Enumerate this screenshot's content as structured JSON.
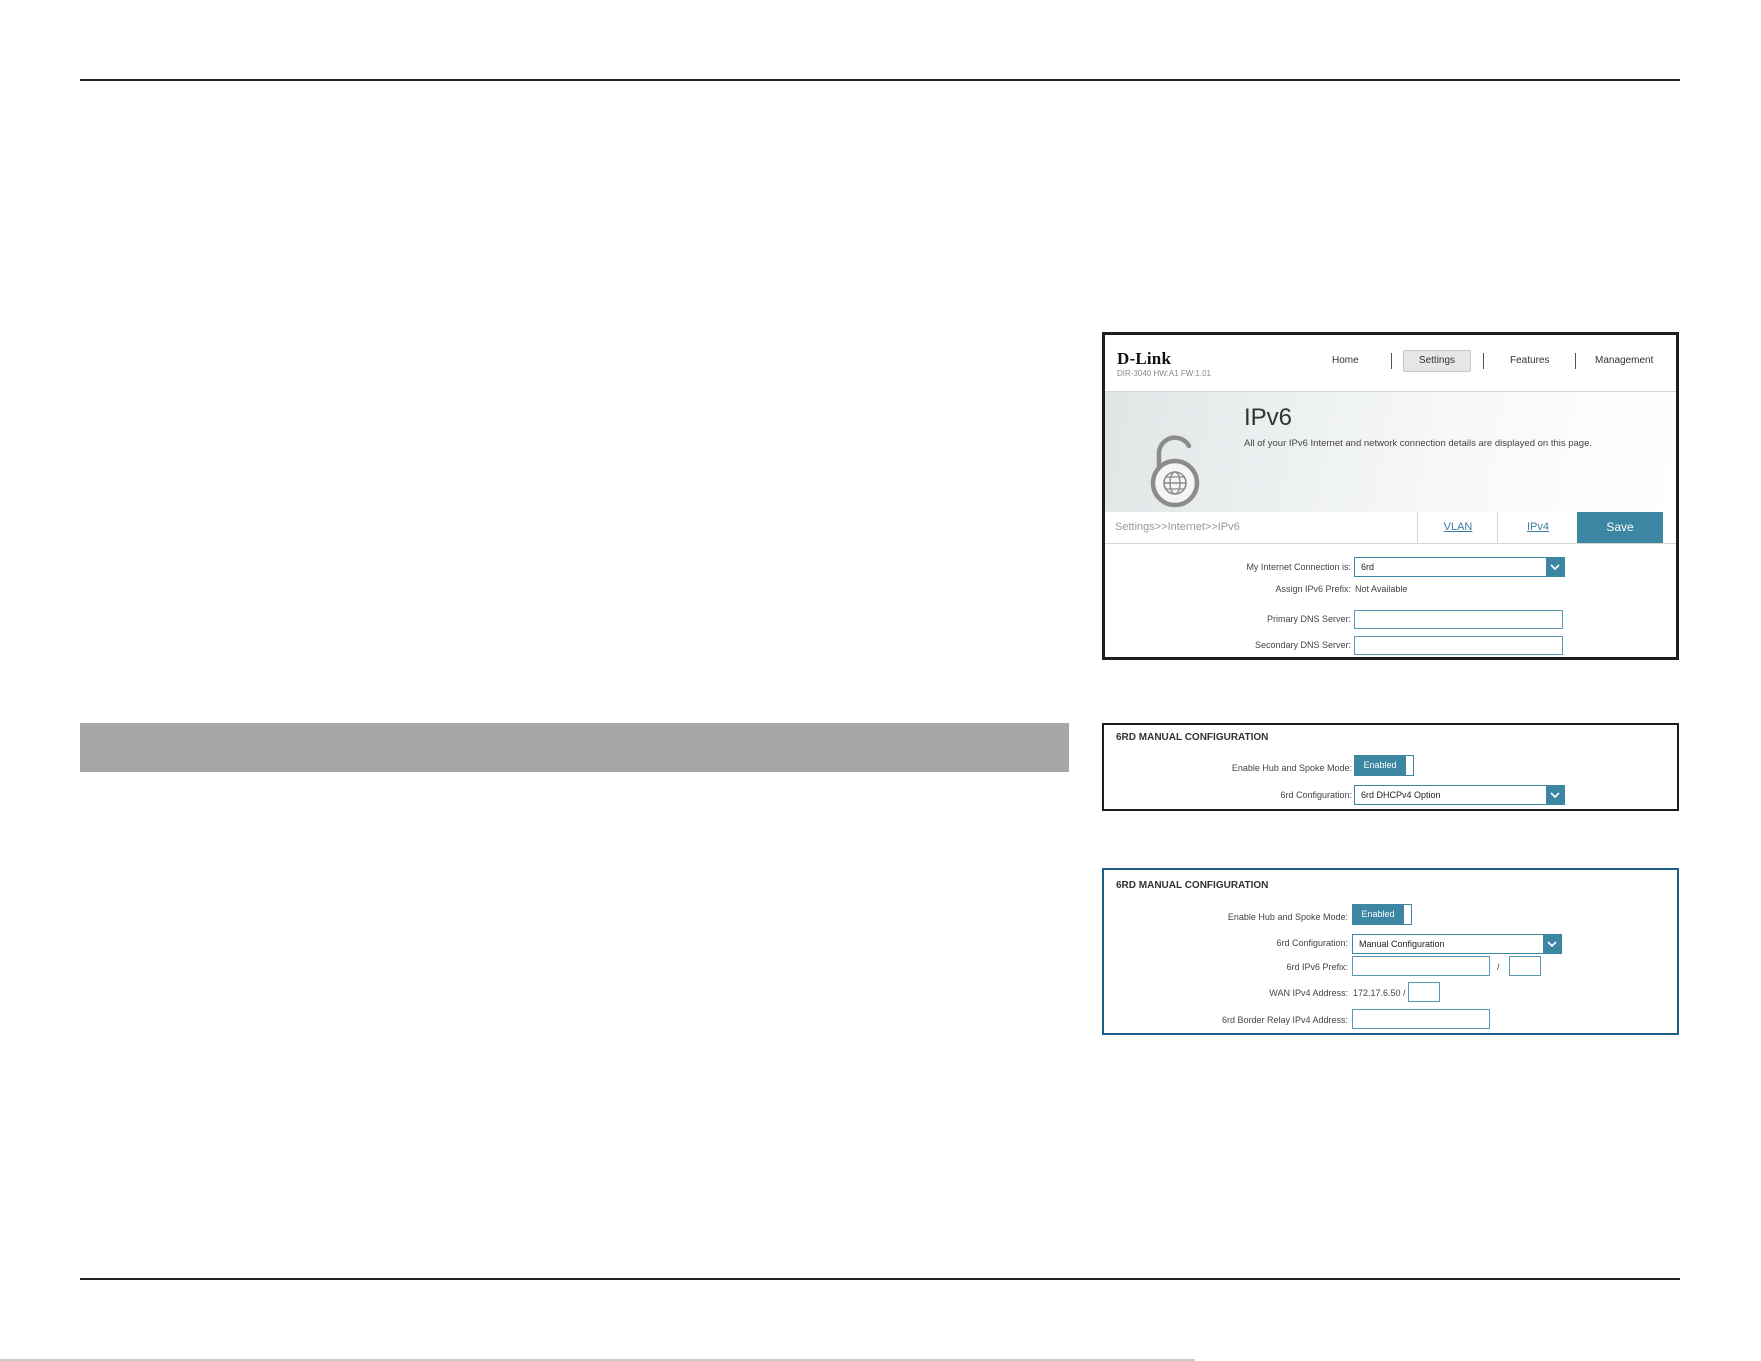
{
  "main": {
    "logo": "D-Link",
    "model": "DIR-3040 HW:A1 FW:1.01",
    "nav": {
      "home": "Home",
      "settings": "Settings",
      "features": "Features",
      "management": "Management"
    },
    "page_title": "IPv6",
    "page_description": "All of your IPv6 Internet and network connection details are displayed on this page.",
    "breadcrumb": "Settings>>Internet>>IPv6",
    "tabs": {
      "vlan": "VLAN",
      "ipv4": "IPv4"
    },
    "save_label": "Save",
    "fields": {
      "connection_label": "My Internet Connection is:",
      "connection_value": "6rd",
      "prefix_label": "Assign IPv6 Prefix:",
      "prefix_value": "Not Available",
      "primary_dns_label": "Primary DNS Server:",
      "secondary_dns_label": "Secondary DNS Server:"
    }
  },
  "panel_dhcp": {
    "heading": "6RD MANUAL CONFIGURATION",
    "hub_spoke_label": "Enable Hub and Spoke Mode:",
    "hub_spoke_state": "Enabled",
    "config_label": "6rd Configuration:",
    "config_value": "6rd DHCPv4 Option"
  },
  "panel_manual": {
    "heading": "6RD MANUAL CONFIGURATION",
    "hub_spoke_label": "Enable Hub and Spoke Mode:",
    "hub_spoke_state": "Enabled",
    "config_label": "6rd Configuration:",
    "config_value": "Manual Configuration",
    "ipv6_prefix_label": "6rd IPv6 Prefix:",
    "prefix_separator": "/",
    "wan_ipv4_label": "WAN IPv4 Address:",
    "wan_ipv4_value": "172.17.6.50 /",
    "border_relay_label": "6rd Border Relay IPv4 Address:"
  },
  "colors": {
    "accent": "#3d86a3",
    "section_bar": "#a6a6a6",
    "frame_highlight": "#1d5f86"
  }
}
